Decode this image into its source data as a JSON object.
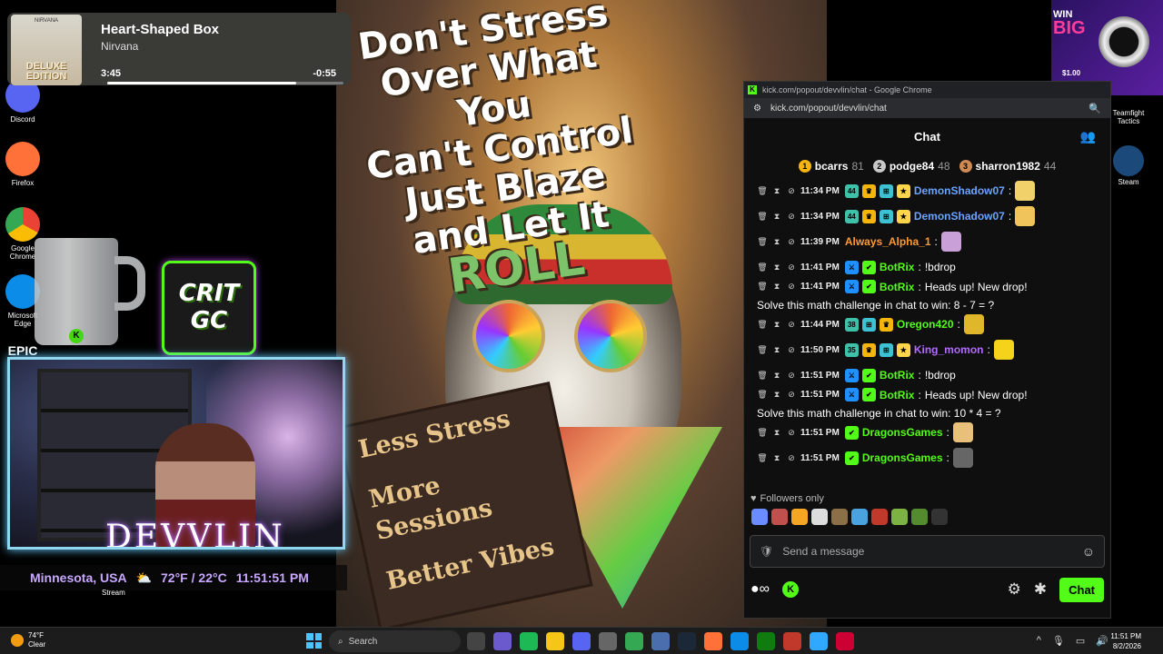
{
  "desktop_icons_left": [
    {
      "label": "Discord",
      "color": "#5865f2"
    },
    {
      "label": "Firefox",
      "color": "#ff7139"
    },
    {
      "label": "Google Chrome",
      "color": "#34a853"
    },
    {
      "label": "Microsoft Edge",
      "color": "#0c8ce9"
    },
    {
      "label": "EPIC",
      "color": "#2a2a2a"
    }
  ],
  "desktop_icons_right": [
    {
      "label": "Teamfight Tactics",
      "color": "#c9a227"
    },
    {
      "label": "Steam",
      "color": "#1b4a7a"
    }
  ],
  "media": {
    "album_band": "NIRVANA",
    "album_label": "DELUXE EDITION",
    "title": "Heart-Shaped Box",
    "artist": "Nirvana",
    "elapsed": "3:45",
    "remaining": "-0:55",
    "progress": 0.8
  },
  "overlay": {
    "crit_line1": "CRIT",
    "crit_line2": "GC",
    "brand": "DEVVLIN",
    "location": "Minnesota, USA",
    "weather": "72°F / 22°C",
    "time": "11:51:51 PM",
    "stream_label": "Stream"
  },
  "watch_ad": {
    "win": "WIN",
    "big": "BIG",
    "price": "$1.00"
  },
  "poster": {
    "slogan_lines": [
      "Don't Stress",
      "Over What You",
      "Can't Control",
      "Just Blaze",
      "and Let It"
    ],
    "slogan_roll": "ROLL",
    "sign_lines": [
      "Less Stress",
      "More Sessions",
      "Better Vibes"
    ]
  },
  "chrome": {
    "window_title": "kick.com/popout/devvlin/chat - Google Chrome",
    "url": "kick.com/popout/devvlin/chat"
  },
  "chat": {
    "header": "Chat",
    "leaderboard": [
      {
        "rank": "1",
        "name": "bcarrs",
        "points": "81",
        "color": "#f5b50b"
      },
      {
        "rank": "2",
        "name": "podge84",
        "points": "48",
        "color": "#c9c9c9"
      },
      {
        "rank": "3",
        "name": "sharron1982",
        "points": "44",
        "color": "#cd8a52"
      }
    ],
    "messages": [
      {
        "time": "11:34 PM",
        "badges": [
          "44",
          "crown",
          "sub",
          "star"
        ],
        "user": "DemonShadow07",
        "user_color": "#6aa3ff",
        "text": "",
        "emote": "#f1d26a",
        "cont": ""
      },
      {
        "time": "11:34 PM",
        "badges": [
          "44",
          "crown",
          "sub",
          "star"
        ],
        "user": "DemonShadow07",
        "user_color": "#6aa3ff",
        "text": "",
        "emote": "#f0c45a",
        "cont": ""
      },
      {
        "time": "11:39 PM",
        "badges": [],
        "user": "Always_Alpha_1",
        "user_color": "#ff9a2f",
        "text": "",
        "emote": "#c9a0d8",
        "cont": ""
      },
      {
        "time": "11:41 PM",
        "badges": [
          "mod",
          "verified"
        ],
        "user": "BotRix",
        "user_color": "#53fc18",
        "text": "!bdrop",
        "emote": "",
        "cont": ""
      },
      {
        "time": "11:41 PM",
        "badges": [
          "mod",
          "verified"
        ],
        "user": "BotRix",
        "user_color": "#53fc18",
        "text": "Heads up! New drop!",
        "emote": "",
        "cont": "Solve this math challenge in chat to win: 8 - 7 = ?"
      },
      {
        "time": "11:44 PM",
        "badges": [
          "38",
          "sub",
          "crown"
        ],
        "user": "Oregon420",
        "user_color": "#53fc18",
        "text": "",
        "emote": "#e0b62a",
        "cont": ""
      },
      {
        "time": "11:50 PM",
        "badges": [
          "35",
          "crown",
          "sub",
          "star"
        ],
        "user": "King_momon",
        "user_color": "#b36bff",
        "text": "",
        "emote": "#f5d31a",
        "cont": ""
      },
      {
        "time": "11:51 PM",
        "badges": [
          "mod",
          "verified"
        ],
        "user": "BotRix",
        "user_color": "#53fc18",
        "text": "!bdrop",
        "emote": "",
        "cont": ""
      },
      {
        "time": "11:51 PM",
        "badges": [
          "mod",
          "verified"
        ],
        "user": "BotRix",
        "user_color": "#53fc18",
        "text": "Heads up! New drop!",
        "emote": "",
        "cont": "Solve this math challenge in chat to win: 10 * 4 = ?"
      },
      {
        "time": "11:51 PM",
        "badges": [
          "verified"
        ],
        "user": "DragonsGames",
        "user_color": "#53fc18",
        "text": "",
        "emote": "#e8c07a",
        "cont": ""
      },
      {
        "time": "11:51 PM",
        "badges": [
          "verified"
        ],
        "user": "DragonsGames",
        "user_color": "#53fc18",
        "text": "",
        "emote": "#666666",
        "cont": ""
      }
    ],
    "followers_only": "Followers only",
    "emote_row_colors": [
      "#6b8cff",
      "#c0504d",
      "#f5a623",
      "#dddddd",
      "#8b6f47",
      "#4aa3df",
      "#c0392b",
      "#7cb342",
      "#558b2f",
      "#333333"
    ],
    "send_placeholder": "Send a message",
    "chat_button": "Chat"
  },
  "taskbar": {
    "temp": "74°F",
    "condition": "Clear",
    "search_placeholder": "Search",
    "app_colors": [
      "#444444",
      "#6a5acd",
      "#1db954",
      "#f5c518",
      "#5865f2",
      "#666666",
      "#34a853",
      "#4b6eaf",
      "#1b2838",
      "#ff7139",
      "#0c8ce9",
      "#107c10",
      "#c0392b",
      "#31a8ff",
      "#cc0033"
    ],
    "time": "11:51 PM",
    "date": "8/2/2026"
  }
}
